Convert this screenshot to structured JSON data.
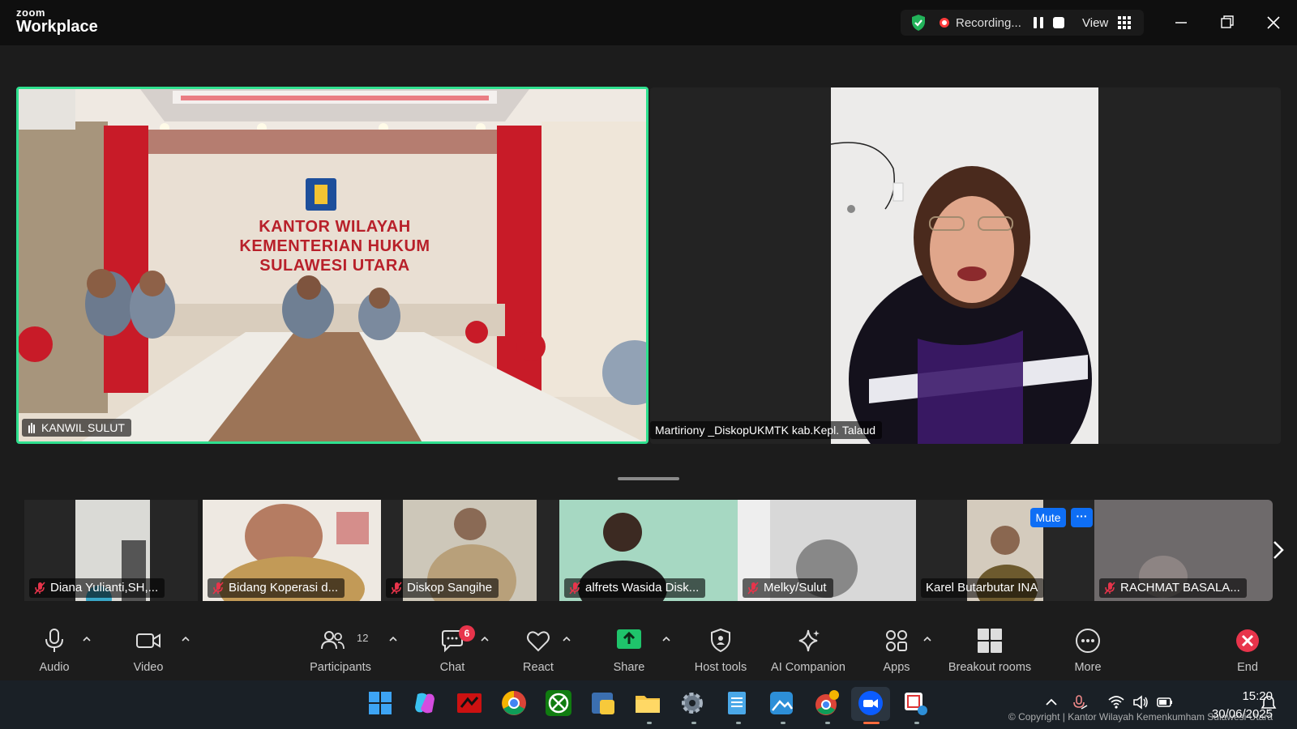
{
  "app": {
    "brand_small": "zoom",
    "brand_large": "Workplace"
  },
  "recording": {
    "label": "Recording...",
    "view_label": "View"
  },
  "main_tiles": [
    {
      "name": "KANWIL SULUT",
      "sign_line1": "KANTOR WILAYAH",
      "sign_line2": "KEMENTERIAN HUKUM",
      "sign_line3": "SULAWESI UTARA",
      "active_speaker": true
    },
    {
      "name": "Martiriony _DiskopUKMTK kab.Kepl. Talaud"
    }
  ],
  "thumbnails": [
    {
      "name": "Diana Yulianti,SH,...",
      "muted": true
    },
    {
      "name": "Bidang Koperasi d...",
      "muted": true
    },
    {
      "name": "Diskop Sangihe",
      "muted": true
    },
    {
      "name": "alfrets Wasida Disk...",
      "muted": true
    },
    {
      "name": "Melky/Sulut",
      "muted": true
    },
    {
      "name": "Karel Butarbutar INA",
      "muted": false
    },
    {
      "name": "RACHMAT BASALA...",
      "muted": true
    }
  ],
  "thumb_controls": {
    "mute_label": "Mute",
    "more_label": "···"
  },
  "toolbar": {
    "audio": "Audio",
    "video": "Video",
    "participants": "Participants",
    "participants_count": "12",
    "chat": "Chat",
    "chat_badge": "6",
    "react": "React",
    "share": "Share",
    "host_tools": "Host tools",
    "ai_companion": "AI Companion",
    "apps": "Apps",
    "breakout_rooms": "Breakout rooms",
    "more": "More",
    "end": "End"
  },
  "taskbar": {
    "time": "15:20",
    "date": "30/06/2025"
  },
  "watermark": "© Copyright | Kantor Wilayah Kemenkumham Sulawesi Utara",
  "colors": {
    "active_border": "#2fe08f",
    "share_green": "#1fc46b",
    "mute_blue": "#0e6ef5",
    "badge_red": "#e8344b",
    "end_red": "#e8344b"
  }
}
